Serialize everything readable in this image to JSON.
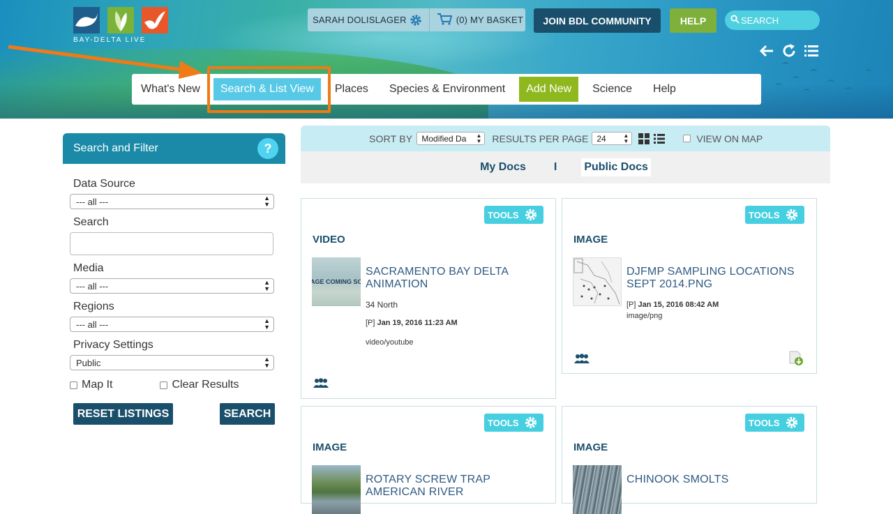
{
  "header": {
    "logo_text": "BAY-DELTA LIVE",
    "user_name": "SARAH DOLISLAGER",
    "basket_label": "(0) MY BASKET",
    "join_label": "JOIN BDL COMMUNITY",
    "help_label": "HELP",
    "search_placeholder": "SEARCH"
  },
  "nav": {
    "items": [
      {
        "label": "What's New"
      },
      {
        "label": "Search & List View"
      },
      {
        "label": "Places"
      },
      {
        "label": "Species & Environment"
      },
      {
        "label": "Add New"
      },
      {
        "label": "Science"
      },
      {
        "label": "Help"
      }
    ],
    "active": "Search & List View"
  },
  "sidebar": {
    "title": "Search and Filter",
    "help_glyph": "?",
    "data_source_label": "Data Source",
    "data_source_value": "--- all ---",
    "search_label": "Search",
    "search_value": "",
    "media_label": "Media",
    "media_value": "--- all ---",
    "regions_label": "Regions",
    "regions_value": "--- all ---",
    "privacy_label": "Privacy Settings",
    "privacy_value": "Public",
    "map_it_label": "Map It",
    "clear_results_label": "Clear Results",
    "reset_label": "RESET LISTINGS",
    "search_button_label": "SEARCH"
  },
  "toolbar": {
    "sort_label": "SORT BY",
    "sort_value": "Modified Da",
    "per_page_label": "RESULTS PER PAGE",
    "per_page_value": "24",
    "view_map_label": "VIEW ON MAP"
  },
  "doctabs": {
    "my_docs": "My Docs",
    "separator": "I",
    "public_docs": "Public Docs"
  },
  "cards": [
    {
      "tools_label": "TOOLS",
      "type": "VIDEO",
      "title": "SACRAMENTO BAY DELTA ANIMATION",
      "author": "34 North",
      "date_prefix": "[P]",
      "date": "Jan 19, 2016 11:23 AM",
      "mime": "video/youtube",
      "thumb_text": "IMAGE COMING SOON"
    },
    {
      "tools_label": "TOOLS",
      "type": "IMAGE",
      "title": "DJFMP SAMPLING LOCATIONS SEPT 2014.PNG",
      "date_prefix": "[P]",
      "date": "Jan 15, 2016 08:42 AM",
      "mime": "image/png"
    },
    {
      "tools_label": "TOOLS",
      "type": "IMAGE",
      "title": "ROTARY SCREW TRAP AMERICAN RIVER"
    },
    {
      "tools_label": "TOOLS",
      "type": "IMAGE",
      "title": "CHINOOK SMOLTS"
    }
  ],
  "colors": {
    "accent_orange": "#f07a16",
    "dark_blue": "#1a4f6b",
    "cyan": "#46cfe0",
    "green": "#7fb03c"
  }
}
